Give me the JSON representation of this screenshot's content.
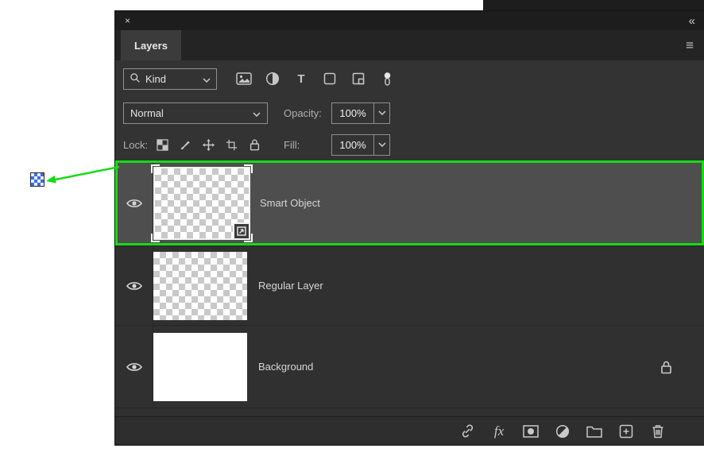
{
  "window": {
    "close_glyph": "×",
    "collapse_glyph": "«",
    "menu_glyph": "≡"
  },
  "panel": {
    "tab_label": "Layers"
  },
  "filter_bar": {
    "kind_label": "Kind",
    "type_filter_glyph": "T",
    "filter_icons": [
      "pixel-layer-filter",
      "adjustment-layer-filter",
      "type-layer-filter",
      "shape-layer-filter",
      "smart-object-filter",
      "filter-toggle-switch"
    ]
  },
  "blend_bar": {
    "mode": "Normal",
    "opacity_label": "Opacity:",
    "opacity_value": "100%"
  },
  "lock_bar": {
    "lock_label": "Lock:",
    "fill_label": "Fill:",
    "fill_value": "100%",
    "lock_icons": [
      "lock-transparency",
      "lock-image",
      "lock-position",
      "lock-artboard",
      "lock-all"
    ]
  },
  "layers": [
    {
      "name": "Smart Object",
      "selected": true,
      "thumbnail": "transparent-checkerboard",
      "badge": "smart-object-badge",
      "visible": true
    },
    {
      "name": "Regular Layer",
      "selected": false,
      "thumbnail": "transparent-checkerboard",
      "visible": true
    },
    {
      "name": "Background",
      "selected": false,
      "thumbnail": "white",
      "locked": true,
      "visible": true
    }
  ],
  "bottom_bar": {
    "fx_label": "fx",
    "icons": [
      "link-layers-icon",
      "layer-effects-button",
      "layer-mask-icon",
      "adjustment-layer-icon",
      "new-group-icon",
      "new-layer-icon",
      "delete-layer-icon"
    ]
  },
  "annotation": {
    "highlight_color": "#16db16",
    "highlighted_layer": "Smart Object"
  }
}
